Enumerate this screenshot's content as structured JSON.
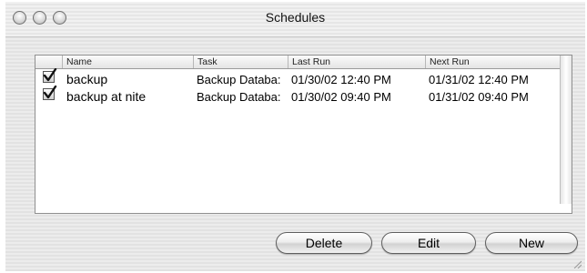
{
  "window": {
    "title": "Schedules"
  },
  "table": {
    "columns": [
      "Name",
      "Task",
      "Last Run",
      "Next Run"
    ],
    "rows": [
      {
        "enabled": true,
        "name": "backup",
        "task": "Backup Databa:",
        "last_run": "01/30/02  12:40  PM",
        "next_run": "01/31/02  12:40  PM"
      },
      {
        "enabled": true,
        "name": "backup at nite",
        "task": "Backup Databa:",
        "last_run": "01/30/02  09:40  PM",
        "next_run": "01/31/02  09:40  PM"
      }
    ]
  },
  "buttons": {
    "delete": "Delete",
    "edit": "Edit",
    "new": "New"
  },
  "icons": [
    "close-icon",
    "minimize-icon",
    "zoom-icon",
    "checkbox-checked-icon",
    "resize-grip-icon"
  ]
}
